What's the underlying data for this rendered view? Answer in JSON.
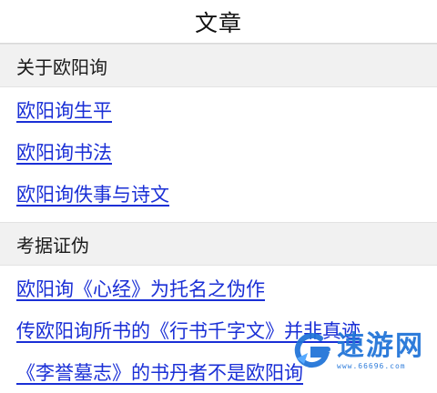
{
  "header": {
    "title": "文章"
  },
  "sections": [
    {
      "title": "关于欧阳询",
      "links": [
        "欧阳询生平",
        "欧阳询书法",
        "欧阳询佚事与诗文"
      ]
    },
    {
      "title": "考据证伪",
      "links": [
        "欧阳询《心经》为托名之伪作",
        "传欧阳询所书的《行书千字文》并非真迹",
        "《李誉墓志》的书丹者不是欧阳询"
      ]
    }
  ],
  "watermark": {
    "text": "速游网",
    "sub": "www.66696.com",
    "color": "#1f73d8"
  },
  "colors": {
    "link": "#1a2fd6",
    "section_bg": "#f1f1f1"
  }
}
